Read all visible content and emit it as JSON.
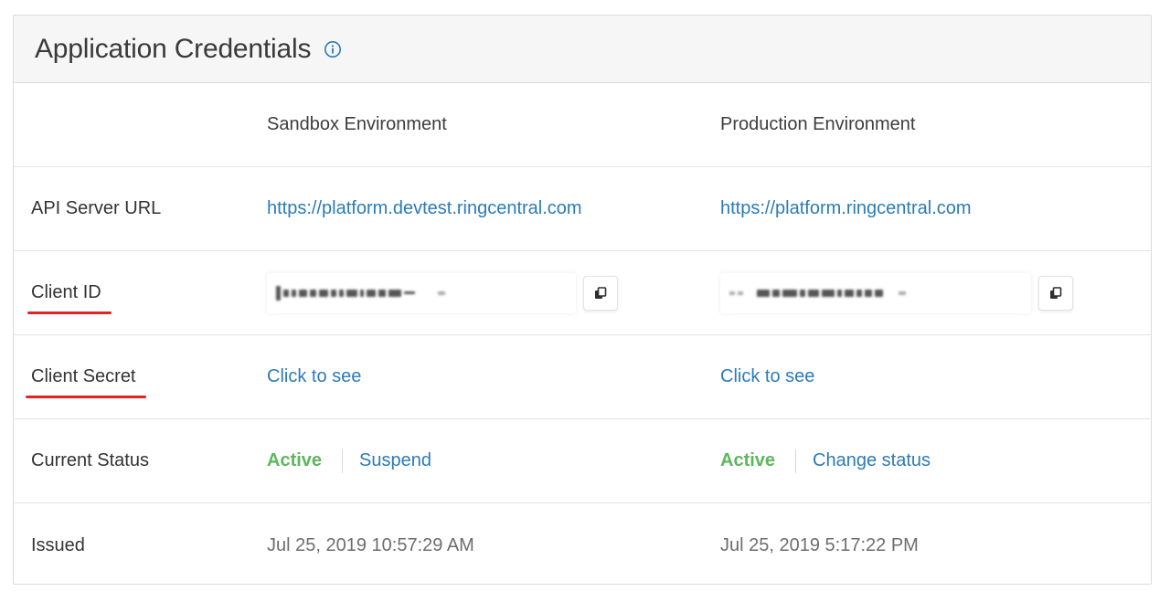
{
  "panel": {
    "title": "Application Credentials",
    "info_icon": "info-circle-icon"
  },
  "columns": {
    "sandbox": "Sandbox Environment",
    "production": "Production Environment"
  },
  "rows": {
    "api_server_url": {
      "label": "API Server URL",
      "sandbox": "https://platform.devtest.ringcentral.com",
      "production": "https://platform.ringcentral.com"
    },
    "client_id": {
      "label": "Client ID",
      "copy_icon": "copy-icon"
    },
    "client_secret": {
      "label": "Client Secret",
      "sandbox": "Click to see",
      "production": "Click to see"
    },
    "current_status": {
      "label": "Current Status",
      "sandbox_status": "Active",
      "sandbox_action": "Suspend",
      "production_status": "Active",
      "production_action": "Change status"
    },
    "issued": {
      "label": "Issued",
      "sandbox": "Jul 25, 2019 10:57:29 AM",
      "production": "Jul 25, 2019 5:17:22 PM"
    }
  },
  "colors": {
    "link": "#2b7bb9",
    "active": "#5cb85c",
    "annotation": "#e02424"
  }
}
